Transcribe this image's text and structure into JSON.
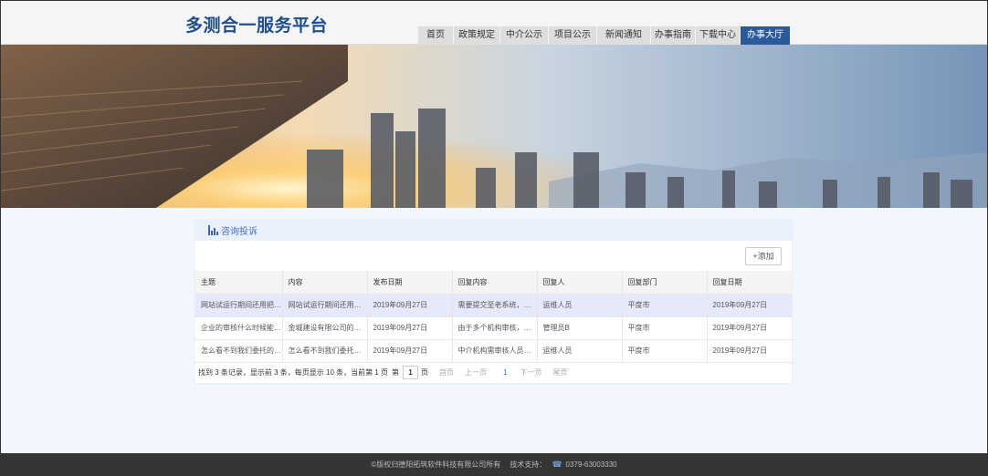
{
  "site": {
    "title": "多测合一服务平台"
  },
  "nav": [
    "首页",
    "政策规定",
    "中介公示",
    "项目公示",
    "新闻通知",
    "办事指南",
    "下载中心",
    "办事大厅"
  ],
  "nav_active": 7,
  "panel": {
    "title": "咨询投诉",
    "add_label": "+添加"
  },
  "table": {
    "headers": [
      "主题",
      "内容",
      "发布日期",
      "回复内容",
      "回复人",
      "回复部门",
      "回复日期"
    ],
    "rows": [
      [
        "网站试运行期间还用把自...",
        "网站试运行期间还用把...",
        "2019年09月27日",
        "需要提交至老系统，待...",
        "运维人员",
        "平度市",
        "2019年09月27日"
      ],
      [
        "企业的审核什么时候能通...",
        "金城建设有限公司的审...",
        "2019年09月27日",
        "由于多个机构审核，需...",
        "管理员B",
        "平度市",
        "2019年09月27日"
      ],
      [
        "怎么看不到我们委托的中...",
        "怎么看不到我们委托的...",
        "2019年09月27日",
        "中介机构需审核人员进...",
        "运维人员",
        "平度市",
        "2019年09月27日"
      ]
    ]
  },
  "pager": {
    "summary": "找到 3 条记录，显示前 3 条，每页显示 10 条，当前第 1 页",
    "page_prefix": "第",
    "page_value": "1",
    "page_suffix": "页",
    "first": "首页",
    "prev": "上一页",
    "current": "1",
    "next": "下一页",
    "last": "尾页"
  },
  "footer": {
    "copyright": "©版权归德阳拓筑软件科技有限公司所有",
    "support_label": "技术支持：",
    "phone": "0379-63003330"
  }
}
